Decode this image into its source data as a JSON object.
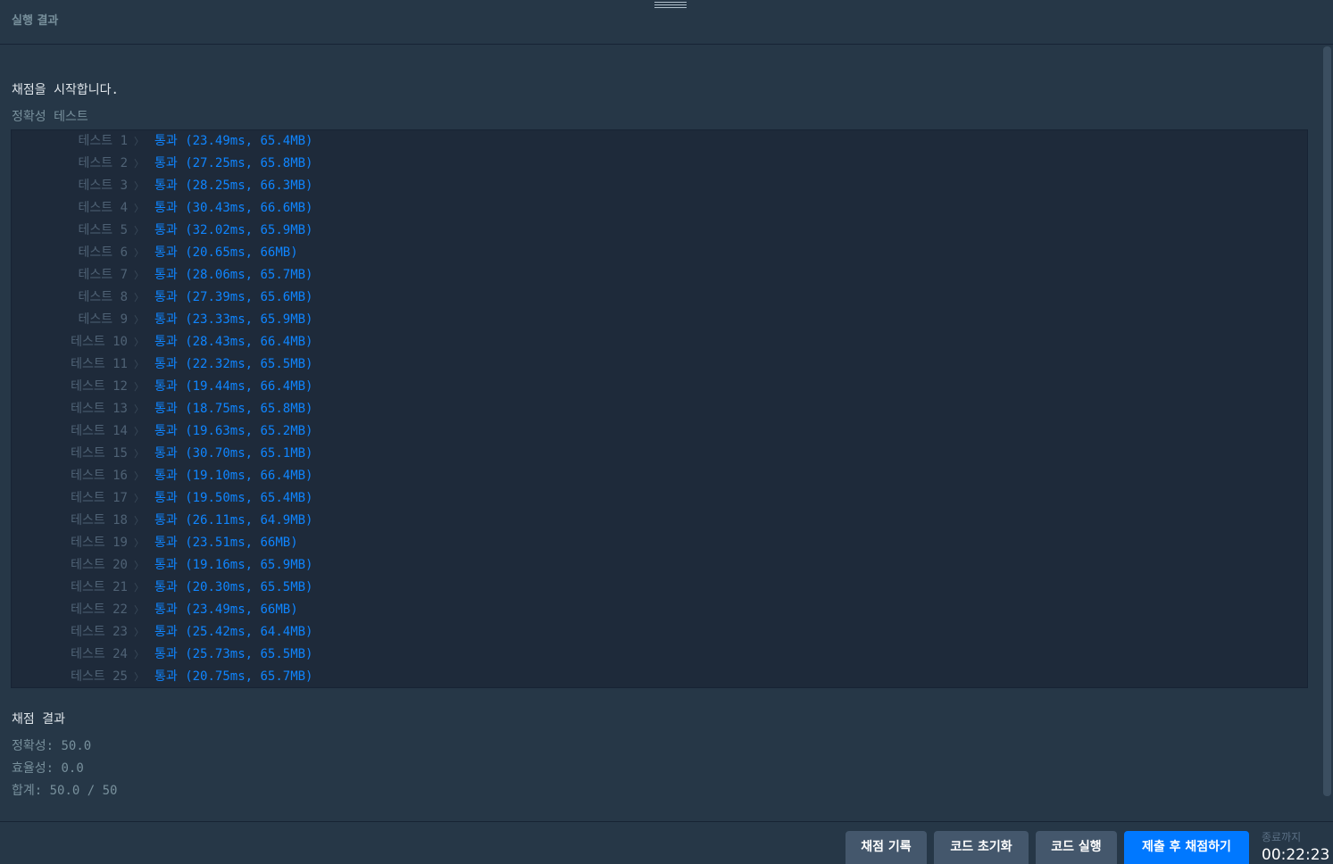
{
  "header": {
    "title": "실행 결과"
  },
  "output": {
    "start_message": "채점을 시작합니다.",
    "section_label": "정확성  테스트",
    "tests": [
      {
        "name": "테스트 1",
        "status": "통과 (23.49ms, 65.4MB)"
      },
      {
        "name": "테스트 2",
        "status": "통과 (27.25ms, 65.8MB)"
      },
      {
        "name": "테스트 3",
        "status": "통과 (28.25ms, 66.3MB)"
      },
      {
        "name": "테스트 4",
        "status": "통과 (30.43ms, 66.6MB)"
      },
      {
        "name": "테스트 5",
        "status": "통과 (32.02ms, 65.9MB)"
      },
      {
        "name": "테스트 6",
        "status": "통과 (20.65ms, 66MB)"
      },
      {
        "name": "테스트 7",
        "status": "통과 (28.06ms, 65.7MB)"
      },
      {
        "name": "테스트 8",
        "status": "통과 (27.39ms, 65.6MB)"
      },
      {
        "name": "테스트 9",
        "status": "통과 (23.33ms, 65.9MB)"
      },
      {
        "name": "테스트 10",
        "status": "통과 (28.43ms, 66.4MB)"
      },
      {
        "name": "테스트 11",
        "status": "통과 (22.32ms, 65.5MB)"
      },
      {
        "name": "테스트 12",
        "status": "통과 (19.44ms, 66.4MB)"
      },
      {
        "name": "테스트 13",
        "status": "통과 (18.75ms, 65.8MB)"
      },
      {
        "name": "테스트 14",
        "status": "통과 (19.63ms, 65.2MB)"
      },
      {
        "name": "테스트 15",
        "status": "통과 (30.70ms, 65.1MB)"
      },
      {
        "name": "테스트 16",
        "status": "통과 (19.10ms, 66.4MB)"
      },
      {
        "name": "테스트 17",
        "status": "통과 (19.50ms, 65.4MB)"
      },
      {
        "name": "테스트 18",
        "status": "통과 (26.11ms, 64.9MB)"
      },
      {
        "name": "테스트 19",
        "status": "통과 (23.51ms, 66MB)"
      },
      {
        "name": "테스트 20",
        "status": "통과 (19.16ms, 65.9MB)"
      },
      {
        "name": "테스트 21",
        "status": "통과 (20.30ms, 65.5MB)"
      },
      {
        "name": "테스트 22",
        "status": "통과 (23.49ms, 66MB)"
      },
      {
        "name": "테스트 23",
        "status": "통과 (25.42ms, 64.4MB)"
      },
      {
        "name": "테스트 24",
        "status": "통과 (25.73ms, 65.5MB)"
      },
      {
        "name": "테스트 25",
        "status": "통과 (20.75ms, 65.7MB)"
      }
    ],
    "summary_title": "채점 결과",
    "summary_lines": [
      "정확성: 50.0",
      "효율성: 0.0",
      "합계: 50.0 / 50"
    ]
  },
  "footer": {
    "buttons": {
      "history": "채점 기록",
      "reset": "코드 초기화",
      "run": "코드 실행",
      "submit": "제출 후 채점하기"
    },
    "timer_label": "종료까지",
    "timer_value": "00:22:23"
  },
  "colors": {
    "pass": "#0f85ff",
    "accent": "#0078ff"
  }
}
